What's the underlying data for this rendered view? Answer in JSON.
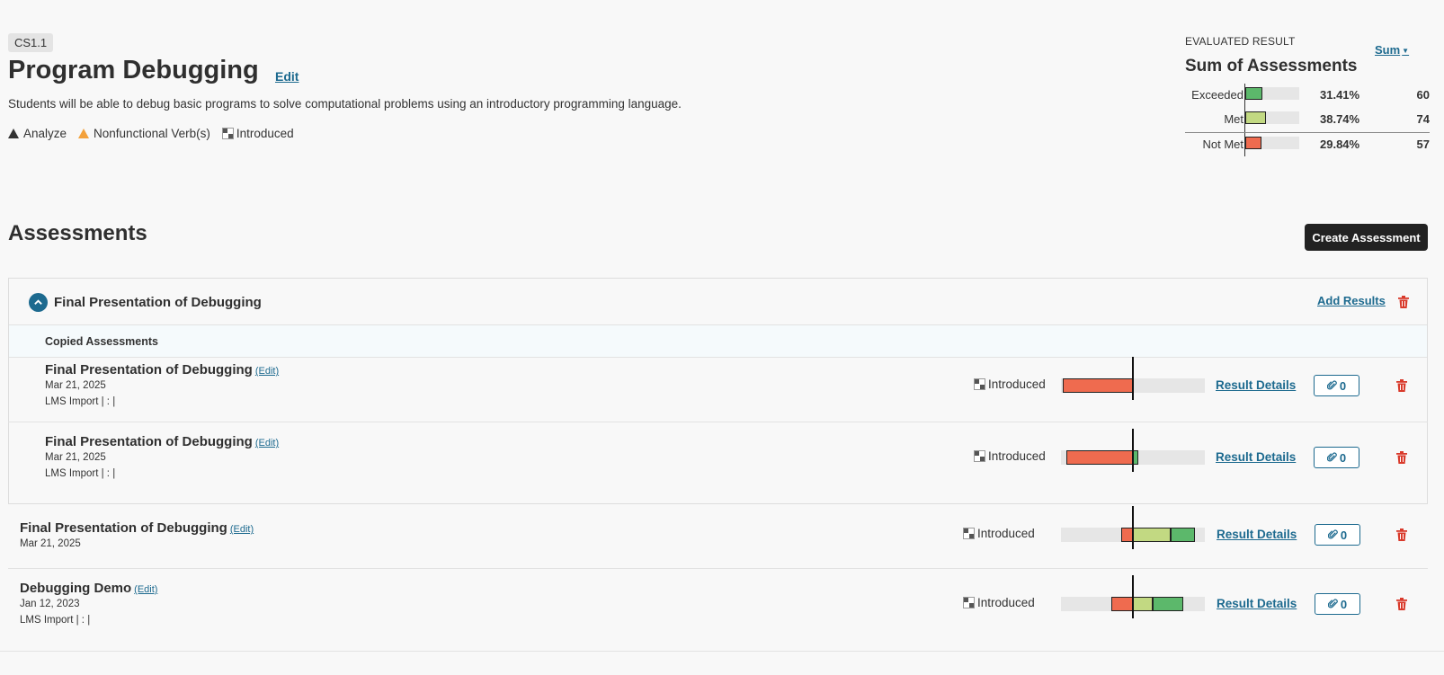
{
  "outcome": {
    "code": "CS1.1",
    "title": "Program Debugging",
    "edit_label": "Edit",
    "description": "Students will be able to debug basic programs to solve computational problems using an introductory programming language.",
    "tags": [
      {
        "icon": "triangle-icon",
        "label": "Analyze"
      },
      {
        "icon": "warning-triangle-icon",
        "label": "Nonfunctional Verb(s)"
      },
      {
        "icon": "level-icon",
        "label": "Introduced"
      }
    ]
  },
  "evaluated": {
    "label": "EVALUATED RESULT",
    "title": "Sum of Assessments",
    "mode": "Sum",
    "rows": [
      {
        "label": "Exceeded",
        "pct": "31.41%",
        "count": "60",
        "fraction": 0.3141,
        "color": "#5cb86b"
      },
      {
        "label": "Met",
        "pct": "38.74%",
        "count": "74",
        "fraction": 0.3874,
        "color": "#c2d982"
      },
      {
        "label": "Not Met",
        "pct": "29.84%",
        "count": "57",
        "fraction": 0.2984,
        "color": "#ef6b4f"
      }
    ]
  },
  "assessments_heading": "Assessments",
  "create_label": "Create Assessment",
  "group": {
    "title": "Final Presentation of Debugging",
    "add_results_label": "Add Results",
    "copied_label": "Copied Assessments"
  },
  "rows": [
    {
      "title": "Final Presentation of Debugging",
      "edit": "(Edit)",
      "date": "Mar 21, 2025",
      "meta": "LMS Import | : |",
      "level": "Introduced",
      "details": "Result Details",
      "attachments": "0",
      "not_met": 0.49,
      "met": 0.0,
      "exceeded": 0.0
    },
    {
      "title": "Final Presentation of Debugging",
      "edit": "(Edit)",
      "date": "Mar 21, 2025",
      "meta": "LMS Import | : |",
      "level": "Introduced",
      "details": "Result Details",
      "attachments": "0",
      "not_met": 0.46,
      "met": 0.0,
      "exceeded": 0.04
    },
    {
      "title": "Final Presentation of Debugging",
      "edit": "(Edit)",
      "date": "Mar 21, 2025",
      "meta": "",
      "level": "Introduced",
      "details": "Result Details",
      "attachments": "0",
      "not_met": 0.08,
      "met": 0.26,
      "exceeded": 0.17
    },
    {
      "title": "Debugging Demo",
      "edit": "(Edit)",
      "date": "Jan 12, 2023",
      "meta": "LMS Import | : |",
      "level": "Introduced",
      "details": "Result Details",
      "attachments": "0",
      "not_met": 0.15,
      "met": 0.14,
      "exceeded": 0.21
    }
  ],
  "colors": {
    "not_met": "#ef6b4f",
    "met": "#c2d982",
    "exceeded": "#5cb86b",
    "accent": "#1d6a8f",
    "danger": "#d93a2b"
  }
}
